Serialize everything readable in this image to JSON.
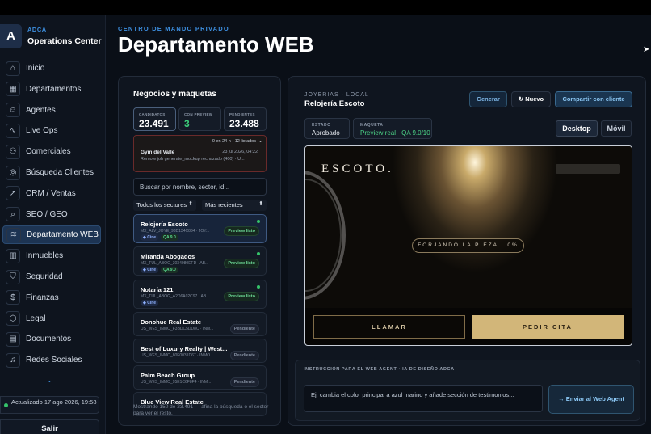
{
  "brand": {
    "logo_letter": "A",
    "org": "ADCA",
    "app": "Operations Center"
  },
  "nav": [
    {
      "label": "Inicio",
      "icon": "home-icon"
    },
    {
      "label": "Departamentos",
      "icon": "grid-icon"
    },
    {
      "label": "Agentes",
      "icon": "agent-icon"
    },
    {
      "label": "Live Ops",
      "icon": "pulse-icon"
    },
    {
      "label": "Comerciales",
      "icon": "users-icon"
    },
    {
      "label": "Búsqueda Clientes",
      "icon": "target-icon"
    },
    {
      "label": "CRM / Ventas",
      "icon": "trend-icon"
    },
    {
      "label": "SEO / GEO",
      "icon": "search-icon"
    },
    {
      "label": "Departamento WEB",
      "icon": "layers-icon",
      "active": true
    },
    {
      "label": "Inmuebles",
      "icon": "building-icon"
    },
    {
      "label": "Seguridad",
      "icon": "shield-icon"
    },
    {
      "label": "Finanzas",
      "icon": "dollar-icon"
    },
    {
      "label": "Legal",
      "icon": "badge-icon"
    },
    {
      "label": "Documentos",
      "icon": "document-icon"
    },
    {
      "label": "Redes Sociales",
      "icon": "bell-icon"
    }
  ],
  "sidebar_footer": {
    "updated": "Actualizado 17 ago 2026, 19:58",
    "logout": "Salir"
  },
  "header": {
    "eyebrow": "CENTRO DE MANDO PRIVADO",
    "title": "Departamento WEB"
  },
  "left_panel": {
    "title": "Negocios y maquetas",
    "stats": [
      {
        "label": "CANDIDATOS",
        "value": "23.491"
      },
      {
        "label": "CON PREVIEW",
        "value": "3"
      },
      {
        "label": "PENDIENTES",
        "value": "23.488"
      }
    ],
    "alert": {
      "header": "0 en 24 h · 12 listados",
      "name": "Gym del Valle",
      "date": "23 jul 2026, 04:22",
      "message": "Remote job generate_mockup rechazado (400) · U..."
    },
    "search_placeholder": "Buscar por nombre, sector, id...",
    "filter_sector": "Todos los sectores",
    "filter_sort": "Más recientes",
    "leads": [
      {
        "name": "Relojería Escoto",
        "id": "MX_ALV_JOYE_98D134C834 · JOY...",
        "tags": [
          "◆ Cine",
          "QA 9.0"
        ],
        "status": "Preview listo"
      },
      {
        "name": "Miranda Abogados",
        "id": "MX_TUL_ABOG_3034980EFD · AB...",
        "tags": [
          "◆ Cine",
          "QA 9.0"
        ],
        "status": "Preview listo"
      },
      {
        "name": "Notaría 121",
        "id": "MX_TUL_ABOG_A2D6A02C97 · AB...",
        "tags": [
          "◆ Cine"
        ],
        "status": "Preview listo"
      },
      {
        "name": "Donohue Real Estate",
        "id": "US_WES_INMO_F3BDC5DD8C · INM...",
        "tags": [],
        "status": "Pendiente"
      },
      {
        "name": "Best of Luxury Realty | West...",
        "id": "US_WES_INMO_80F0031D67 · INMO...",
        "tags": [],
        "status": "Pendiente"
      },
      {
        "name": "Palm Beach Group",
        "id": "US_WES_INMO_95E1C6F8F4 · INM...",
        "tags": [],
        "status": "Pendiente"
      },
      {
        "name": "Blue View Real Estate",
        "id": "",
        "tags": [],
        "status": ""
      }
    ],
    "footer": "Mostrando 150 de 23.491 — afina la búsqueda o el sector para ver el resto."
  },
  "right_panel": {
    "eyebrow": "JOYERIAS · LOCAL",
    "title": "Relojería Escoto",
    "btn_generate": "Generar",
    "btn_new": "↻ Nuevo",
    "btn_share": "Compartir con cliente",
    "state_label": "ESTADO",
    "state_value": "Aprobado",
    "mockup_label": "MAQUETA",
    "mockup_value": "Preview real · QA 9.0/10",
    "view_desktop": "Desktop",
    "view_mobile": "Móvil",
    "preview": {
      "logo": "ESCOTO.",
      "progress_text": "FORJANDO LA PIEZA · 0%",
      "cta_call": "LLAMAR",
      "cta_book": "PEDIR CITA"
    },
    "instruction": {
      "label": "INSTRUCCIÓN PARA EL WEB AGENT · IA DE DISEÑO ADCA",
      "placeholder": "Ej: cambia el color principal a azul marino y añade sección de testimonios...",
      "send": "→  Enviar al Web Agent"
    }
  }
}
